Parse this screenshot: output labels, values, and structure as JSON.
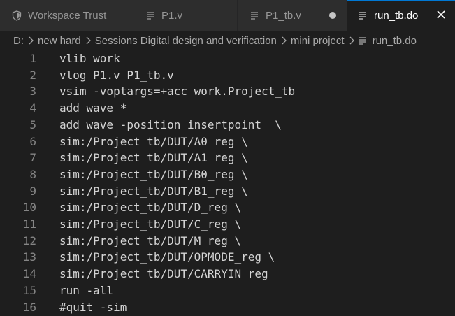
{
  "tabs": [
    {
      "label": "Workspace Trust",
      "icon": "shield-icon"
    },
    {
      "label": "P1.v",
      "icon": "lines-file-icon"
    },
    {
      "label": "P1_tb.v",
      "icon": "lines-file-icon",
      "modified": true
    },
    {
      "label": "run_tb.do",
      "icon": "lines-file-icon",
      "active": true
    }
  ],
  "breadcrumb": [
    "D:",
    "new hard",
    "Sessions Digital design and verification",
    "mini project",
    "run_tb.do"
  ],
  "editor": {
    "lines": [
      {
        "n": "1",
        "text": "vlib work"
      },
      {
        "n": "2",
        "text": "vlog P1.v P1_tb.v"
      },
      {
        "n": "3",
        "text": "vsim -voptargs=+acc work.Project_tb"
      },
      {
        "n": "4",
        "text": "add wave *"
      },
      {
        "n": "5",
        "text": "add wave -position insertpoint  \\"
      },
      {
        "n": "6",
        "text": "sim:/Project_tb/DUT/A0_reg \\"
      },
      {
        "n": "7",
        "text": "sim:/Project_tb/DUT/A1_reg \\"
      },
      {
        "n": "8",
        "text": "sim:/Project_tb/DUT/B0_reg \\"
      },
      {
        "n": "9",
        "text": "sim:/Project_tb/DUT/B1_reg \\"
      },
      {
        "n": "10",
        "text": "sim:/Project_tb/DUT/D_reg \\"
      },
      {
        "n": "11",
        "text": "sim:/Project_tb/DUT/C_reg \\"
      },
      {
        "n": "12",
        "text": "sim:/Project_tb/DUT/M_reg \\"
      },
      {
        "n": "13",
        "text": "sim:/Project_tb/DUT/OPMODE_reg \\"
      },
      {
        "n": "14",
        "text": "sim:/Project_tb/DUT/CARRYIN_reg"
      },
      {
        "n": "15",
        "text": "run -all"
      },
      {
        "n": "16",
        "text": "#quit -sim"
      }
    ]
  },
  "colors": {
    "editor_bg": "#1e1e1e",
    "tab_inactive_bg": "#2d2d2d",
    "active_tab_accent": "#0078d4",
    "line_number": "#858585",
    "code_text": "#d4d4d4"
  }
}
